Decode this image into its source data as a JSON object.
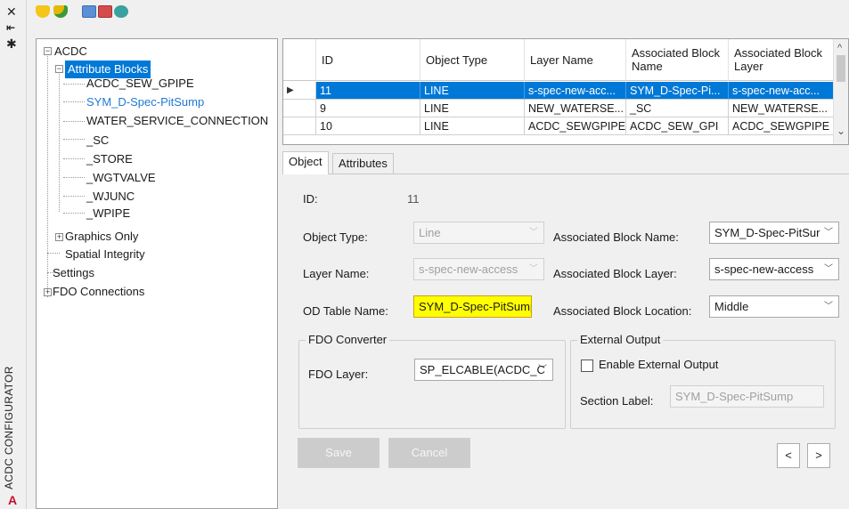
{
  "palette": {
    "title": "ACDC CONFIGURATOR",
    "icons": [
      "close-icon",
      "pin-icon",
      "properties-icon",
      "autocad-logo"
    ],
    "close_glyph": "✕",
    "pin_glyph": "⇤",
    "props_glyph": "✱",
    "logo_glyph": "A"
  },
  "toolbar": {
    "icons": [
      "shield-yellow-icon",
      "shield-check-icon",
      "grid-icon",
      "grid-red-icon",
      "refresh-icon"
    ]
  },
  "tree": {
    "root": "ACDC",
    "attribute_blocks": "Attribute Blocks",
    "children": [
      "ACDC_SEW_GPIPE",
      "SYM_D-Spec-PitSump",
      "WATER_SERVICE_CONNECTION",
      "_SC",
      "_STORE",
      "_WGTVALVE",
      "_WJUNC",
      "_WPIPE"
    ],
    "graphics_only": "Graphics Only",
    "spatial_integrity": "Spatial Integrity",
    "settings": "Settings",
    "fdo_connections": "FDO Connections"
  },
  "grid": {
    "headers": [
      "ID",
      "Object Type",
      "Layer Name",
      "Associated Block Name",
      "Associated Block Layer"
    ],
    "rows": [
      [
        "11",
        "LINE",
        "s-spec-new-acc...",
        "SYM_D-Spec-Pi...",
        "s-spec-new-acc..."
      ],
      [
        "9",
        "LINE",
        "NEW_WATERSE...",
        "_SC",
        "NEW_WATERSE..."
      ],
      [
        "10",
        "LINE",
        "ACDC_SEWGPIPE",
        "ACDC_SEW_GPI",
        "ACDC_SEWGPIPE"
      ]
    ],
    "row_indicator": "▶"
  },
  "tabs": [
    "Object",
    "Attributes"
  ],
  "form": {
    "id_label": "ID:",
    "id_value": "11",
    "object_type_label": "Object Type:",
    "object_type_value": "Line",
    "layer_name_label": "Layer Name:",
    "layer_name_value": "s-spec-new-access",
    "od_table_label": "OD Table Name:",
    "od_table_value": "SYM_D-Spec-PitSump",
    "assoc_block_name_label": "Associated Block Name:",
    "assoc_block_name_value": "SYM_D-Spec-PitSur",
    "assoc_block_layer_label": "Associated Block Layer:",
    "assoc_block_layer_value": "s-spec-new-access",
    "assoc_block_location_label": "Associated Block Location:",
    "assoc_block_location_value": "Middle",
    "fdo_group_title": "FDO Converter",
    "fdo_layer_label": "FDO Layer:",
    "fdo_layer_value": "SP_ELCABLE(ACDC_C",
    "ext_group_title": "External Output",
    "enable_ext_label": "Enable External Output",
    "enable_ext_checked": false,
    "section_label": "Section Label:",
    "section_value": "SYM_D-Spec-PitSump"
  },
  "buttons": {
    "save": "Save",
    "cancel": "Cancel",
    "prev": "<",
    "next": ">"
  },
  "glyphs": {
    "dropdown": "﹀",
    "minus": "−",
    "plus": "+",
    "scroll_up": "^",
    "scroll_down": "⌄"
  },
  "colors": {
    "selection": "#0078d7",
    "highlight": "#ffff00",
    "tree_link": "#1e7ad6",
    "logo": "#c8102e"
  }
}
